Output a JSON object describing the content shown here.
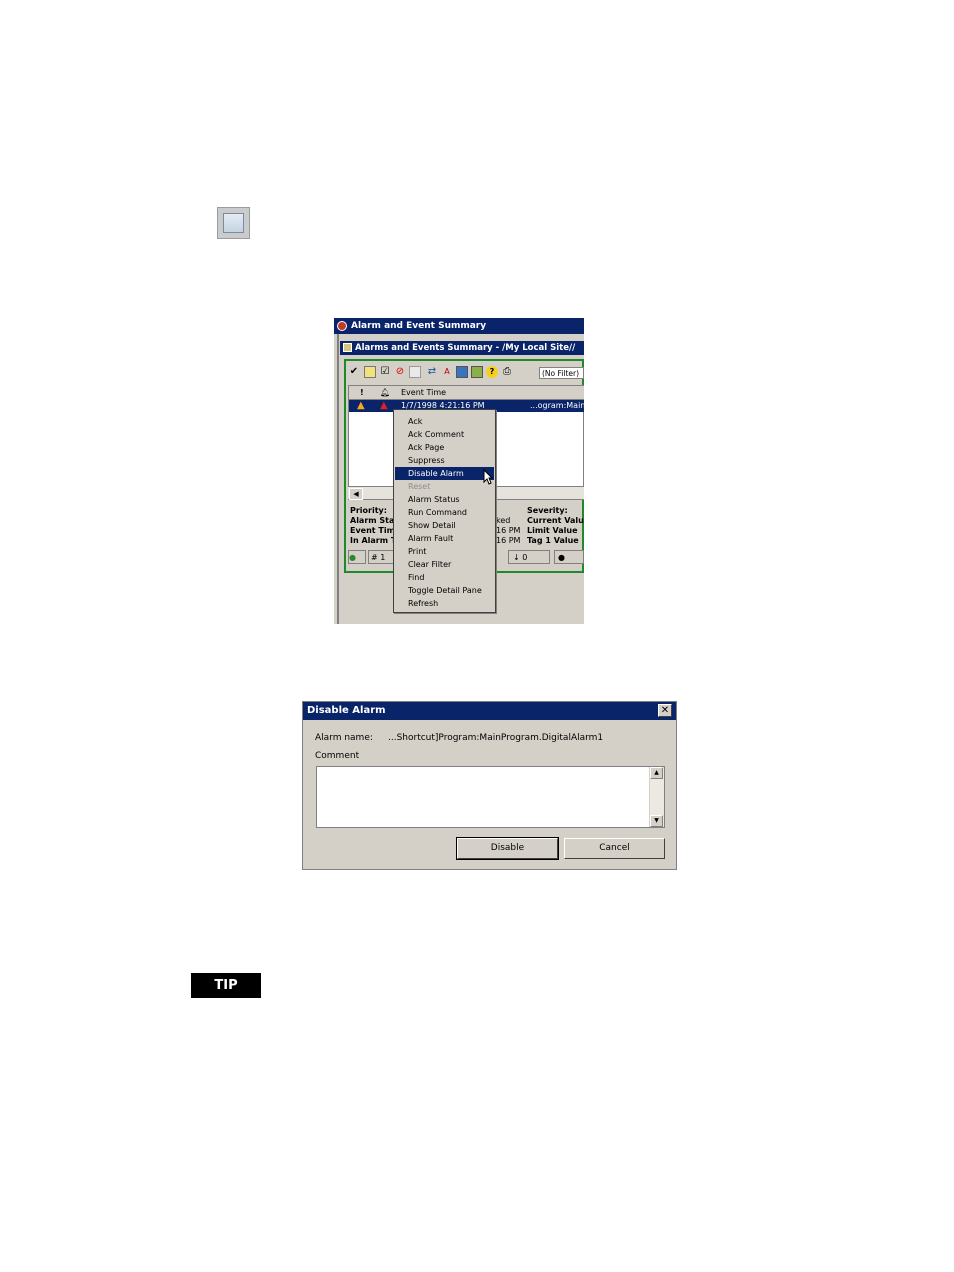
{
  "screenshot1": {
    "window_title": "Alarm and Event Summary",
    "inner_title": "Alarms and Events Summary - /My Local Site//",
    "filter": "(No Filter)",
    "columns": [
      "!",
      "Event Time"
    ],
    "row": {
      "event_time": "1/7/1998 4:21:16 PM",
      "tag": "...ogram:Main"
    },
    "detail_left": [
      "Priority:",
      "Alarm Stat",
      "Event Tim",
      "In Alarm T"
    ],
    "detail_mid": [
      "ked",
      "16 PM",
      "16 PM"
    ],
    "detail_right": [
      "Severity:",
      "Current Valu",
      "Limit Value",
      "Tag 1 Value"
    ],
    "status": {
      "count": "1",
      "unacked": "0"
    },
    "context_menu": [
      "Ack",
      "Ack Comment",
      "Ack Page",
      "Suppress",
      "Disable Alarm",
      "Reset",
      "Alarm Status",
      "Run Command",
      "Show Detail",
      "Alarm Fault",
      "Print",
      "Clear Filter",
      "Find",
      "Toggle Detail Pane",
      "Refresh"
    ],
    "highlighted_item": "Disable Alarm",
    "disabled_item": "Reset"
  },
  "dialog": {
    "title": "Disable Alarm",
    "close_glyph": "✕",
    "alarm_name_label": "Alarm name:",
    "alarm_name_value": "...Shortcut]Program:MainProgram.DigitalAlarm1",
    "comment_label": "Comment",
    "disable_label": "Disable",
    "cancel_label": "Cancel"
  },
  "tip": {
    "label": "TIP"
  }
}
